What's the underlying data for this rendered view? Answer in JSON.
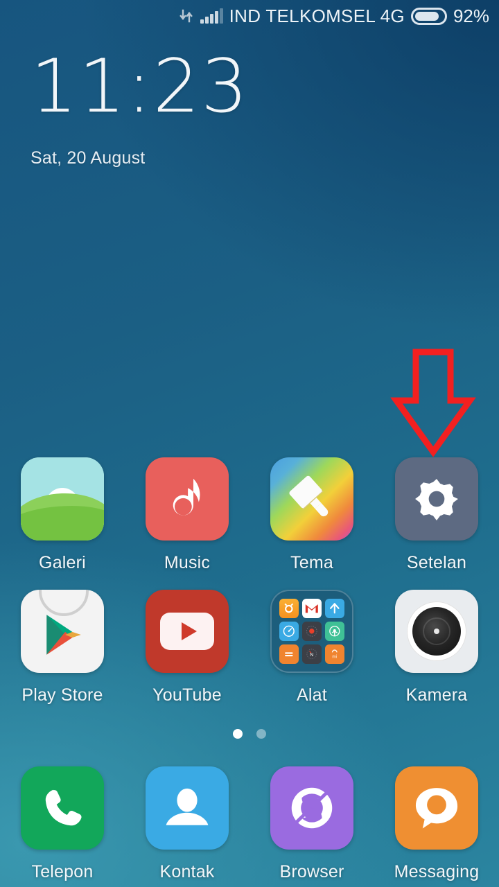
{
  "status_bar": {
    "data_icon": "data-transfer-icon",
    "signal_icon": "signal-bars-icon",
    "carrier": "IND TELKOMSEL 4G",
    "battery_icon": "battery-icon",
    "battery_percent": "92%"
  },
  "clock_widget": {
    "time": "11:23",
    "date": "Sat, 20 August"
  },
  "annotation": {
    "arrow_color": "#f32020",
    "highlight_color": "#f32020",
    "target": "Setelan"
  },
  "home_screen": {
    "rows": [
      {
        "apps": [
          {
            "label": "Galeri",
            "icon": "gallery-icon"
          },
          {
            "label": "Music",
            "icon": "music-note-icon"
          },
          {
            "label": "Tema",
            "icon": "themes-brush-icon"
          },
          {
            "label": "Setelan",
            "icon": "settings-gear-icon"
          }
        ]
      },
      {
        "apps": [
          {
            "label": "Play Store",
            "icon": "play-store-icon"
          },
          {
            "label": "YouTube",
            "icon": "youtube-icon"
          },
          {
            "label": "Alat",
            "icon": "tools-folder-icon"
          },
          {
            "label": "Kamera",
            "icon": "camera-lens-icon"
          }
        ]
      }
    ],
    "folder_alat": {
      "mini_icons": [
        {
          "name": "clock-alarm-icon",
          "color": "#f5a623"
        },
        {
          "name": "gmail-icon",
          "color": "#ffffff"
        },
        {
          "name": "uparrow-icon",
          "color": "#3aaae4"
        },
        {
          "name": "stopwatch-icon",
          "color": "#3aaae4"
        },
        {
          "name": "recorder-icon",
          "color": "#3c3f46"
        },
        {
          "name": "fm-radio-icon",
          "color": "#3fc196"
        },
        {
          "name": "calculator-icon",
          "color": "#f0842f"
        },
        {
          "name": "compass-icon",
          "color": "#3c3f46"
        },
        {
          "name": "mi-store-icon",
          "color": "#f0842f"
        }
      ]
    },
    "page_indicator": {
      "total": 2,
      "active_index": 0
    },
    "dock": {
      "apps": [
        {
          "label": "Telepon",
          "icon": "phone-icon"
        },
        {
          "label": "Kontak",
          "icon": "contacts-person-icon"
        },
        {
          "label": "Browser",
          "icon": "browser-icon"
        },
        {
          "label": "Messaging",
          "icon": "message-bubble-icon"
        }
      ]
    }
  }
}
